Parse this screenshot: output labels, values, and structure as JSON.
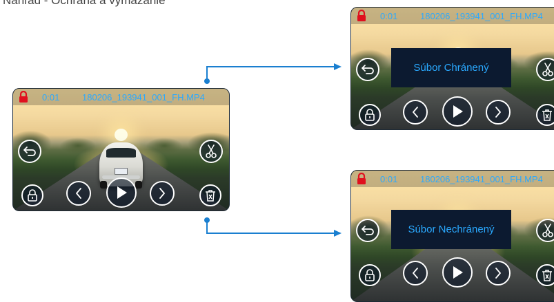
{
  "page_title": "Náhľad - Ochrana a vymazanie",
  "main_screen": {
    "time": "0:01",
    "filename": "180206_193941_001_FH.MP4"
  },
  "protected_screen": {
    "time": "0:01",
    "filename": "180206_193941_001_FH.MP4",
    "banner": "Súbor Chránený"
  },
  "unprotected_screen": {
    "time": "0:01",
    "filename": "180206_193941_001_FH.MP4",
    "banner": "Súbor Nechránený"
  },
  "icons": {
    "lock": "lock-icon",
    "back": "back-arrow-icon",
    "scissors": "scissors-icon",
    "protect": "padlock-icon",
    "prev": "chevron-left-icon",
    "play": "play-icon",
    "next": "chevron-right-icon",
    "delete": "trash-icon"
  },
  "colors": {
    "accent": "#2aa9ff",
    "lock": "#e0101e",
    "connector": "#1a7fd0",
    "banner_bg": "#0c1a30"
  }
}
